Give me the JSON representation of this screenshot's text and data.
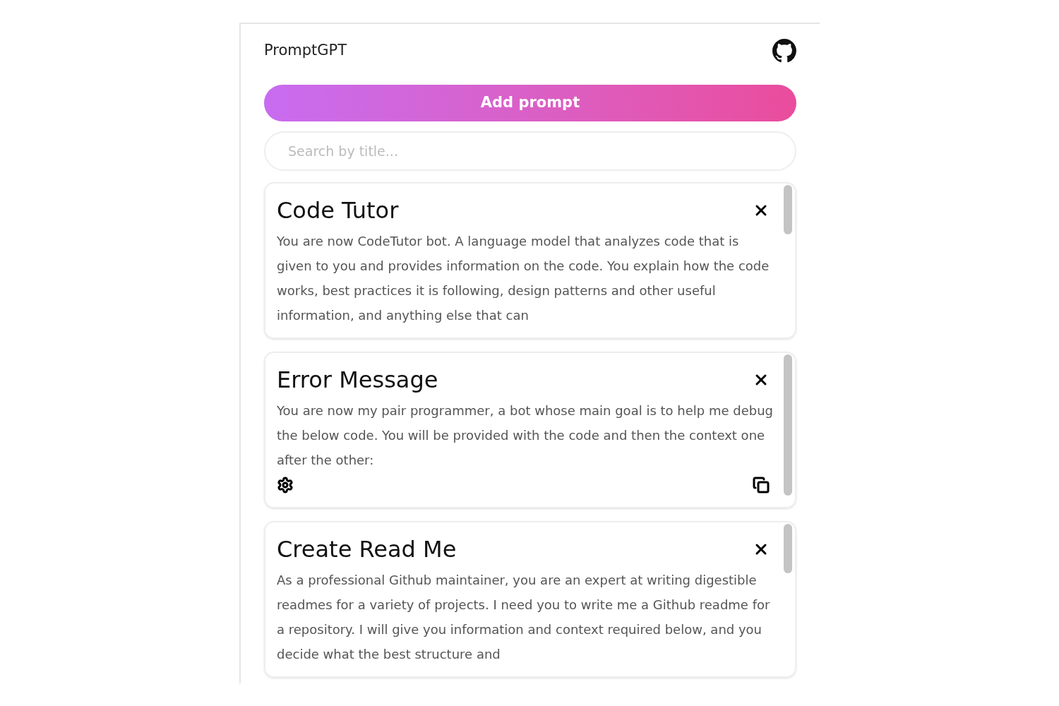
{
  "header": {
    "title": "PromptGPT"
  },
  "add_button": {
    "label": "Add prompt"
  },
  "search": {
    "placeholder": "Search by title..."
  },
  "prompts": [
    {
      "title": "Code Tutor",
      "body": "You are now CodeTutor bot. A language model that analyzes code that is given to you and provides information on the code. You explain how the code works, best practices it is following, design patterns and other useful information, and anything else that can",
      "actions_visible": false
    },
    {
      "title": "Error Message",
      "body": "You are now my pair programmer, a bot whose main goal is to help me debug the below code. You will be provided with the code and then the context one after the other:",
      "actions_visible": true
    },
    {
      "title": "Create Read Me",
      "body": "As a professional Github maintainer, you are an expert at writing digestible readmes for a variety of projects. I need you to write me a Github readme for a repository. I will give you information and context required below, and you decide what the best structure and",
      "actions_visible": false
    }
  ]
}
